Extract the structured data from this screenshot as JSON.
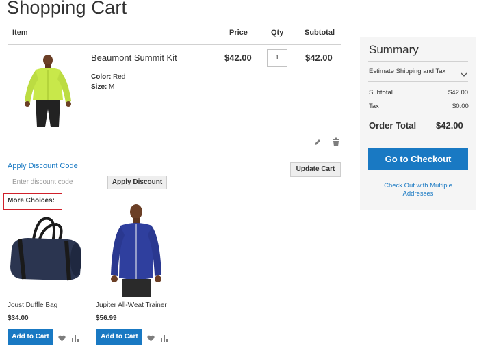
{
  "page": {
    "title": "Shopping Cart"
  },
  "cart_table": {
    "columns": {
      "item": "Item",
      "price": "Price",
      "qty": "Qty",
      "subtotal": "Subtotal"
    },
    "rows": [
      {
        "name": "Beaumont Summit Kit",
        "options": [
          {
            "label": "Color:",
            "value": "Red"
          },
          {
            "label": "Size:",
            "value": "M"
          }
        ],
        "price": "$42.00",
        "qty": "1",
        "subtotal": "$42.00",
        "actions": {
          "edit_icon": "pencil-icon",
          "delete_icon": "trash-icon"
        }
      }
    ]
  },
  "discount": {
    "link": "Apply Discount Code",
    "placeholder": "Enter discount code",
    "apply_label": "Apply Discount"
  },
  "update_cart_label": "Update Cart",
  "more_choices": {
    "label": "More Choices:",
    "items": [
      {
        "name": "Joust Duffle Bag",
        "price": "$34.00",
        "add_to_cart": "Add to Cart",
        "wishlist_icon": "heart-icon",
        "compare_icon": "compare-bars-icon"
      },
      {
        "name": "Jupiter All-Weat Trainer",
        "price": "$56.99",
        "add_to_cart": "Add to Cart",
        "wishlist_icon": "heart-icon",
        "compare_icon": "compare-bars-icon"
      }
    ]
  },
  "summary": {
    "title": "Summary",
    "estimate_label": "Estimate Shipping and Tax",
    "estimate_icon": "chevron-down-icon",
    "subtotal_label": "Subtotal",
    "subtotal_value": "$42.00",
    "tax_label": "Tax",
    "tax_value": "$0.00",
    "order_total_label": "Order Total",
    "order_total_value": "$42.00",
    "checkout_label": "Go to Checkout",
    "multi_address_link": "Check Out with Multiple Addresses"
  },
  "colors": {
    "link": "#1979c3",
    "primary_button": "#1979c3",
    "highlight_box": "#d0202a",
    "summary_bg": "#f5f5f5"
  }
}
